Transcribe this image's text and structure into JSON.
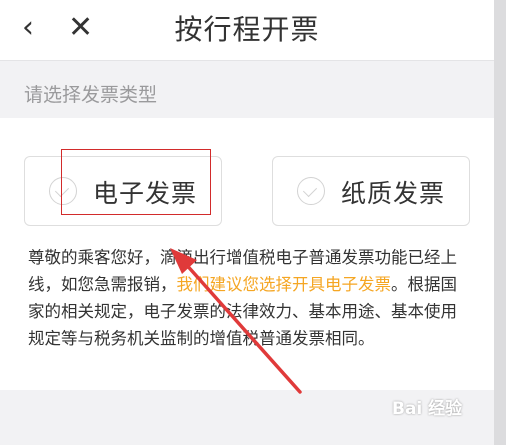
{
  "header": {
    "back_icon": "‹",
    "close_icon": "✕",
    "title": "按行程开票"
  },
  "invoice_type": {
    "label": "请选择发票类型",
    "options": [
      {
        "label": "电子发票",
        "selected": false
      },
      {
        "label": "纸质发票",
        "selected": false
      }
    ]
  },
  "description": {
    "part1": "尊敬的乘客您好，滴滴出行增值税电子普通发票功能已经上线，如您急需报销，",
    "highlight": "我们建议您选择开具电子发票",
    "part2": "。根据国家的相关规定，电子发票的法律效力、基本用途、基本使用规定等与税务机关监制的增值税普通发票相同。"
  },
  "watermark": "Bai 经验",
  "colors": {
    "highlight_text": "#f5a623",
    "annotation_red": "#d22b2b"
  }
}
